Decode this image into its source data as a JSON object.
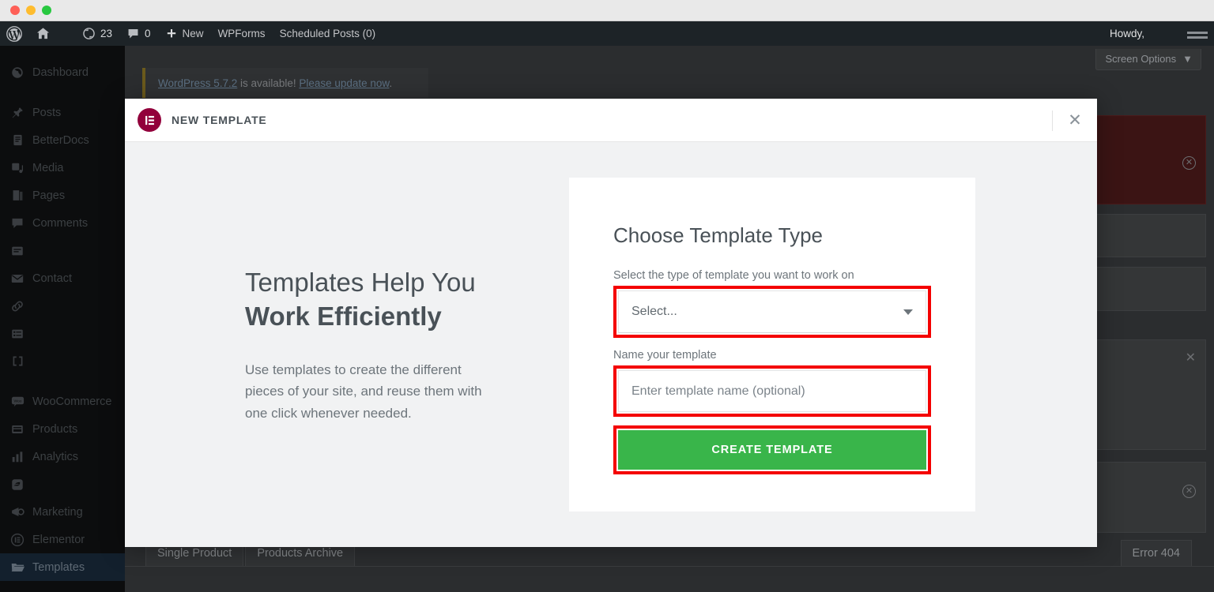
{
  "window": {
    "traffic_lights": [
      "close",
      "minimize",
      "maximize"
    ]
  },
  "adminbar": {
    "wp_logo": "wordpress-logo",
    "site_home": "home-icon",
    "updates_icon": "updates-icon",
    "updates_count": "23",
    "comments_icon": "comments-icon",
    "comments_count": "0",
    "new_icon": "plus-icon",
    "new_label": "New",
    "wpforms_label": "WPForms",
    "scheduled_label": "Scheduled Posts (0)",
    "howdy_label": "Howdy,"
  },
  "sidebar": {
    "items": [
      {
        "label": "Dashboard",
        "icon": "dashboard-icon",
        "active": false
      },
      {
        "label": "Posts",
        "icon": "pin-icon",
        "active": false
      },
      {
        "label": "BetterDocs",
        "icon": "document-icon",
        "active": false
      },
      {
        "label": "Media",
        "icon": "media-icon",
        "active": false
      },
      {
        "label": "Pages",
        "icon": "pages-icon",
        "active": false
      },
      {
        "label": "Comments",
        "icon": "comments-icon",
        "active": false
      },
      {
        "label": "",
        "icon": "forms-icon",
        "active": false
      },
      {
        "label": "Contact",
        "icon": "envelope-icon",
        "active": false
      },
      {
        "label": "",
        "icon": "link-icon",
        "active": false
      },
      {
        "label": "",
        "icon": "list-icon",
        "active": false
      },
      {
        "label": "",
        "icon": "bracket-icon",
        "active": false
      },
      {
        "label": "WooCommerce",
        "icon": "woocommerce-icon",
        "active": false
      },
      {
        "label": "Products",
        "icon": "products-icon",
        "active": false
      },
      {
        "label": "Analytics",
        "icon": "analytics-icon",
        "active": false
      },
      {
        "label": "",
        "icon": "leaf-icon",
        "active": false
      },
      {
        "label": "Marketing",
        "icon": "megaphone-icon",
        "active": false
      },
      {
        "label": "Elementor",
        "icon": "elementor-icon",
        "active": false
      },
      {
        "label": "Templates",
        "icon": "folder-icon",
        "active": true
      }
    ]
  },
  "background": {
    "screen_options_label": "Screen Options",
    "update_notice": {
      "link_version": "WordPress 5.7.2",
      "middle_text": " is available! ",
      "link_action": "Please update now",
      "period": "."
    },
    "bottom_tabs": [
      "Single Product",
      "Products Archive"
    ],
    "error_tab": "Error 404"
  },
  "modal": {
    "logo_name": "elementor-logo",
    "title": "NEW TEMPLATE",
    "close_icon": "close-icon",
    "left": {
      "headline_line1": "Templates Help You",
      "headline_line2": "Work Efficiently",
      "description": "Use templates to create the different pieces of your site, and reuse them with one click whenever needed."
    },
    "card": {
      "title": "Choose Template Type",
      "type_label": "Select the type of template you want to work on",
      "type_value": "Select...",
      "name_label": "Name your template",
      "name_placeholder": "Enter template name (optional)",
      "name_value": "",
      "submit_label": "CREATE TEMPLATE"
    }
  },
  "colors": {
    "accent_green": "#39b54a",
    "highlight_red": "#f40000",
    "elementor_crimson": "#92003b",
    "admin_dark": "#1d2327"
  }
}
